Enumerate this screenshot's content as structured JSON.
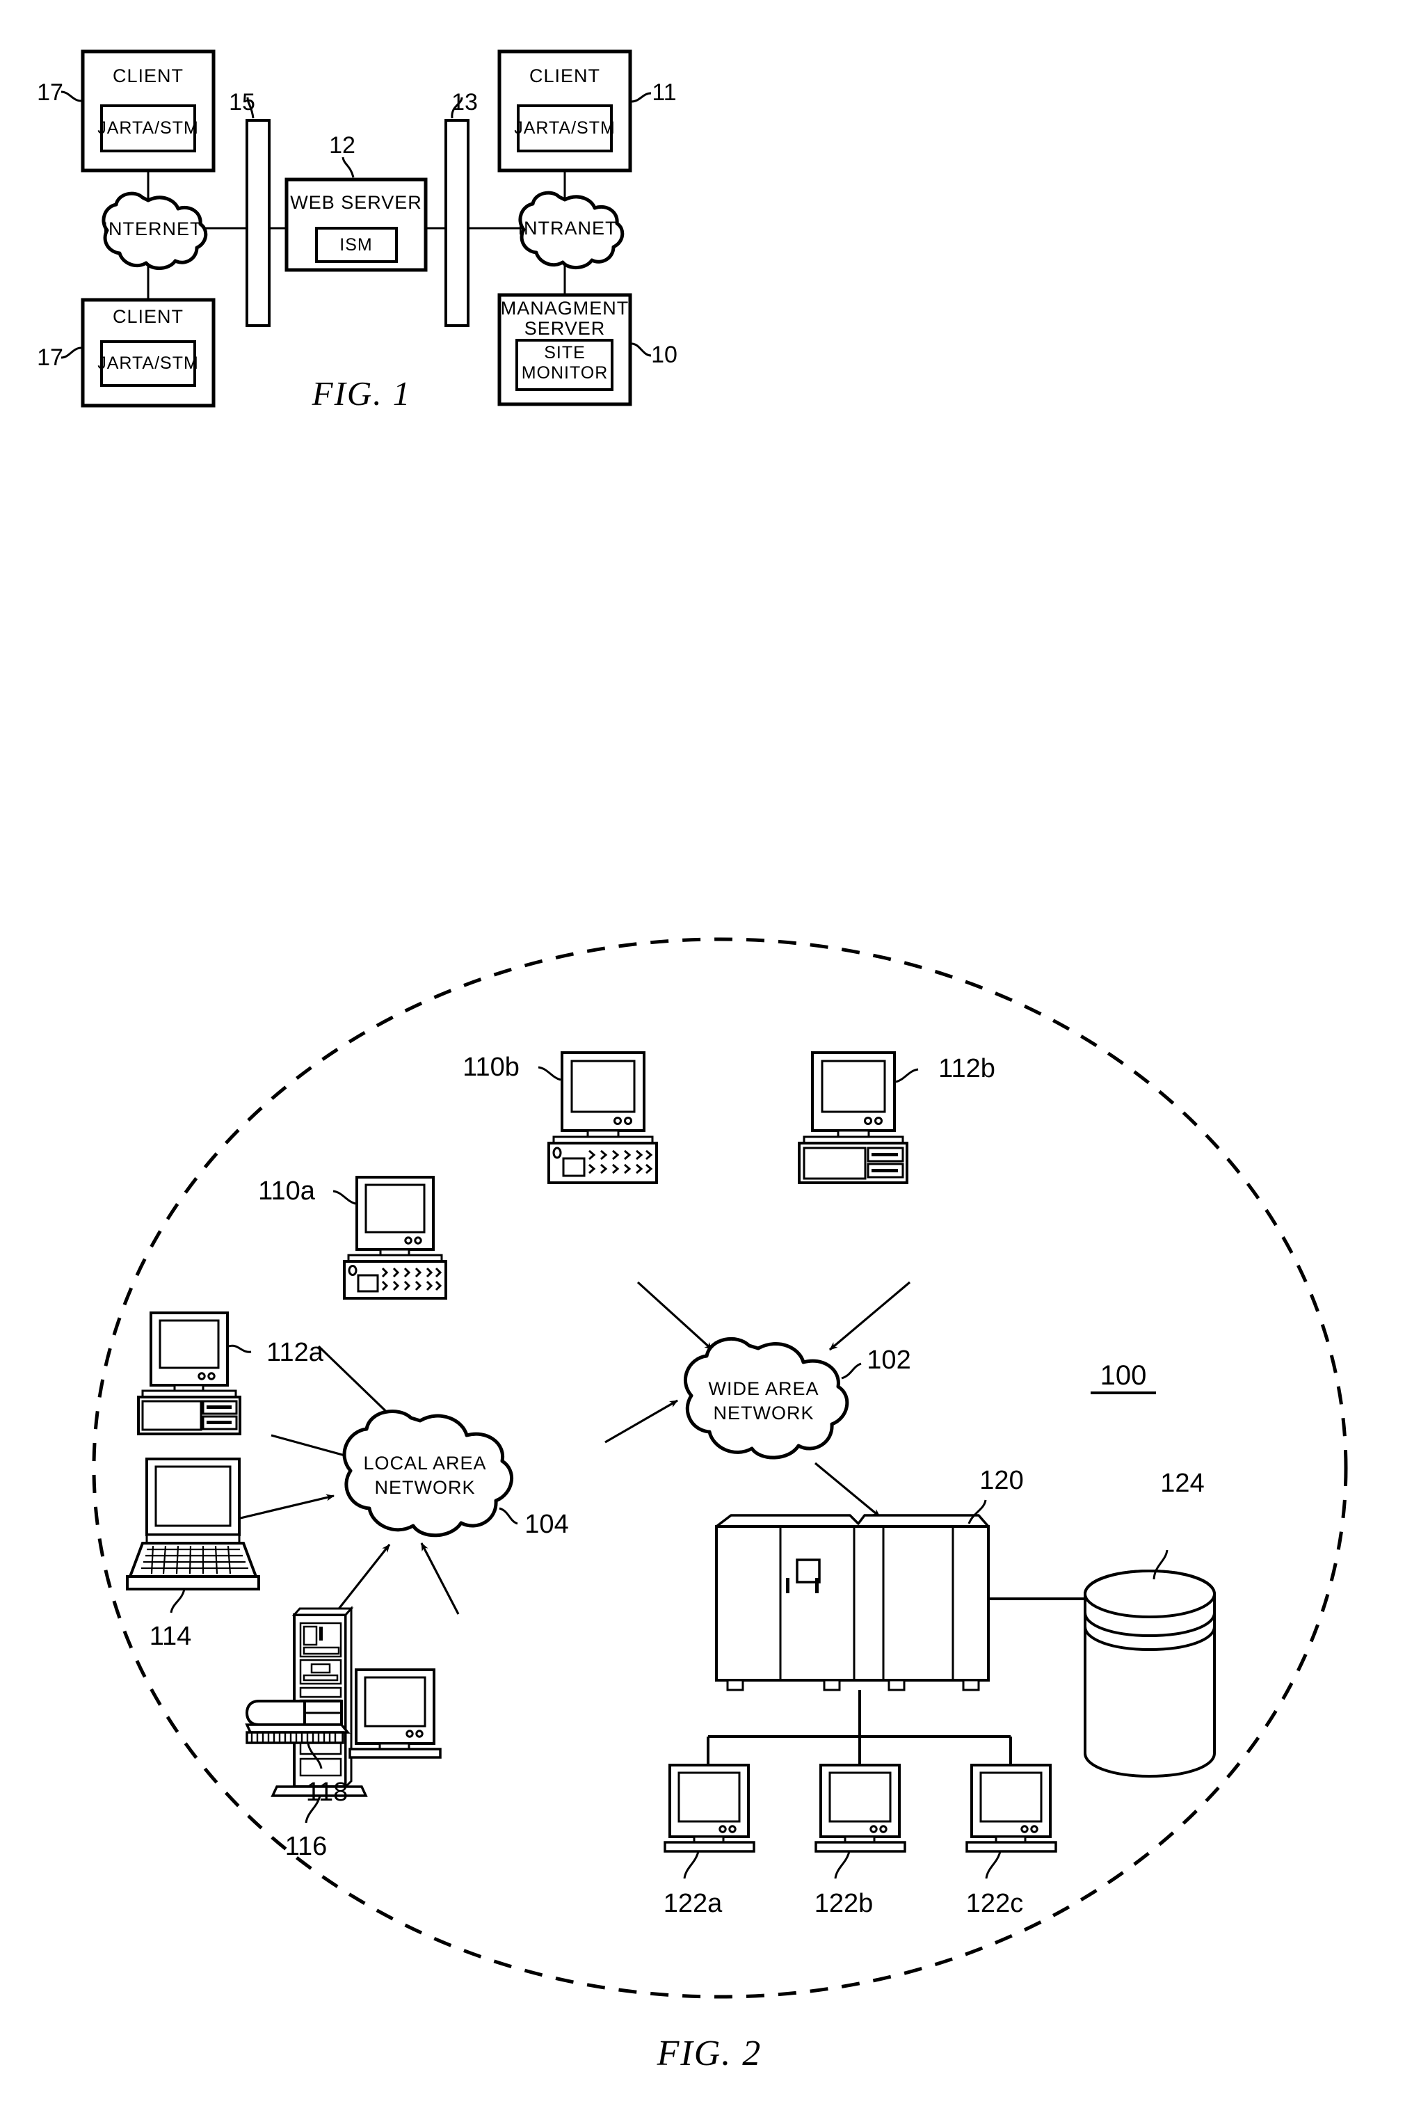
{
  "figures": [
    {
      "id": "fig1",
      "caption": "FIG.  1",
      "nodes": {
        "client_top_left": {
          "title": "CLIENT",
          "inner": "JARTA/STM",
          "ref": "17"
        },
        "client_bottom_left": {
          "title": "CLIENT",
          "inner": "JARTA/STM",
          "ref": "17"
        },
        "client_top_right": {
          "title": "CLIENT",
          "inner": "JARTA/STM",
          "ref": "11"
        },
        "management_server": {
          "title_line1": "MANAGMENT",
          "title_line2": "SERVER",
          "inner_line1": "SITE",
          "inner_line2": "MONITOR",
          "ref": "10"
        },
        "web_server": {
          "title": "WEB SERVER",
          "inner": "ISM",
          "ref": "12"
        },
        "internet_cloud": {
          "label": "INTERNET"
        },
        "intranet_cloud": {
          "label": "INTRANET"
        },
        "firewall_left": {
          "ref": "15"
        },
        "firewall_right": {
          "ref": "13"
        }
      }
    },
    {
      "id": "fig2",
      "caption": "FIG.  2",
      "system_ref": "100",
      "nodes": {
        "wan_cloud": {
          "line1": "WIDE  AREA",
          "line2": "NETWORK",
          "ref": "102"
        },
        "lan_cloud": {
          "line1": "LOCAL  AREA",
          "line2": "NETWORK",
          "ref": "104"
        },
        "desktop_110a": {
          "ref": "110a"
        },
        "desktop_110b": {
          "ref": "110b"
        },
        "desktop_112a": {
          "ref": "112a"
        },
        "desktop_112b": {
          "ref": "112b"
        },
        "laptop_114": {
          "ref": "114"
        },
        "tower_116": {
          "ref": "116"
        },
        "device_118": {
          "ref": "118"
        },
        "mainframe_120": {
          "ref": "120"
        },
        "storage_124": {
          "ref": "124"
        },
        "terminal_122a": {
          "ref": "122a"
        },
        "terminal_122b": {
          "ref": "122b"
        },
        "terminal_122c": {
          "ref": "122c"
        }
      }
    }
  ],
  "colors": {
    "ink": "#000000",
    "paper": "#ffffff"
  }
}
